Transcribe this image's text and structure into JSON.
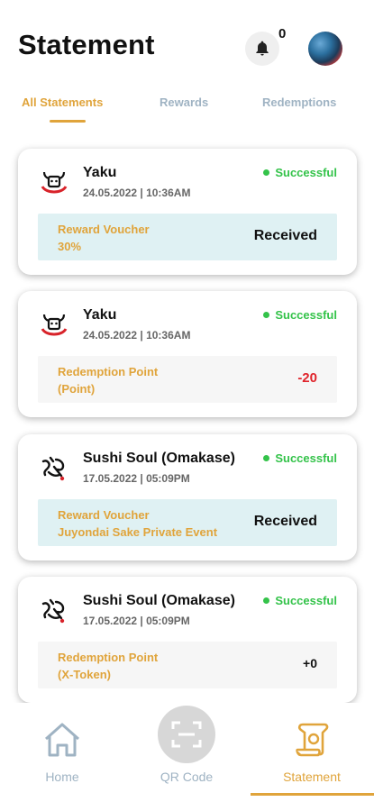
{
  "header": {
    "title": "Statement",
    "notification_count": "0"
  },
  "tabs": [
    {
      "label": "All Statements",
      "active": true
    },
    {
      "label": "Rewards",
      "active": false
    },
    {
      "label": "Redemptions",
      "active": false
    }
  ],
  "statements": [
    {
      "merchant": "Yaku",
      "date": "24.05.2022 | 10:36AM",
      "status": "Successful",
      "detail_label": "Reward Voucher\n30%",
      "detail_value": "Received",
      "logo": "yaku-bull-logo-icon"
    },
    {
      "merchant": "Yaku",
      "date": "24.05.2022 | 10:36AM",
      "status": "Successful",
      "detail_label": "Redemption Point\n(Point)",
      "detail_value": "-20",
      "logo": "yaku-bull-logo-icon"
    },
    {
      "merchant": "Sushi Soul (Omakase)",
      "date": "17.05.2022 | 05:09PM",
      "status": "Successful",
      "detail_label": "Reward Voucher\nJuyondai Sake Private Event",
      "detail_value": "Received",
      "logo": "sushi-soul-logo-icon"
    },
    {
      "merchant": "Sushi Soul (Omakase)",
      "date": "17.05.2022 | 05:09PM",
      "status": "Successful",
      "detail_label": "Redemption Point\n(X-Token)",
      "detail_value": "+0",
      "logo": "sushi-soul-logo-icon"
    }
  ],
  "bottom_nav": [
    {
      "label": "Home",
      "icon": "home-icon",
      "active": false
    },
    {
      "label": "QR Code",
      "icon": "qr-scan-icon",
      "active": false
    },
    {
      "label": "Statement",
      "icon": "scroll-icon",
      "active": true
    }
  ],
  "colors": {
    "accent": "#e0a43b",
    "success": "#34c34a",
    "negative": "#e0242b",
    "inactive": "#9fb3c3"
  }
}
